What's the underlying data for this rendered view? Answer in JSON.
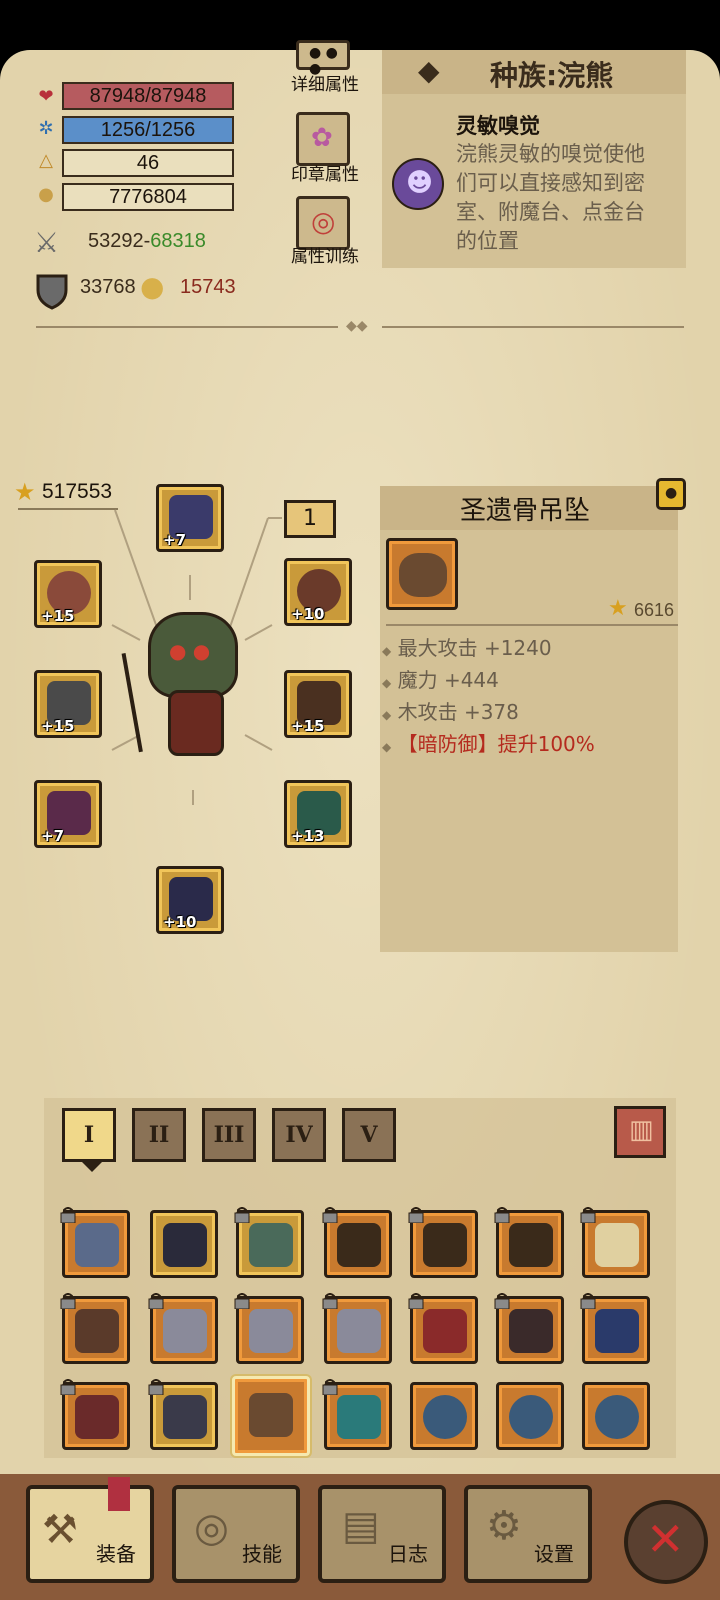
{
  "stats": {
    "hp": "87948/87948",
    "mp": "1256/1256",
    "level": "46",
    "gold": "7776804",
    "attack_min": "53292",
    "attack_dash": "-",
    "attack_max": "68318",
    "defense": "33768",
    "magic": "15743"
  },
  "menu": {
    "detail": "详细属性",
    "seal": "印章属性",
    "training": "属性训练"
  },
  "race": {
    "title": "种族:浣熊",
    "skill_name": "灵敏嗅觉",
    "skill_desc_1": "浣熊灵敏的嗅觉使他",
    "skill_desc_2": "们可以直接感知到密",
    "skill_desc_3": "室、附魔台、点金台",
    "skill_desc_4": "的位置"
  },
  "equipment": {
    "score": "517553",
    "ring_slot_number": "1",
    "slots": [
      {
        "name": "helmet",
        "plus": "+7"
      },
      {
        "name": "necklace",
        "plus": "+10"
      },
      {
        "name": "shield",
        "plus": "+15"
      },
      {
        "name": "weapon",
        "plus": "+15"
      },
      {
        "name": "armor",
        "plus": "+15"
      },
      {
        "name": "gloves",
        "plus": "+7"
      },
      {
        "name": "belt",
        "plus": "+13"
      },
      {
        "name": "boots",
        "plus": "+10"
      }
    ]
  },
  "item_detail": {
    "name": "圣遗骨吊坠",
    "score": "6616",
    "attr_1": "最大攻击 +1240",
    "attr_2": "魔力 +444",
    "attr_3": "木攻击 +378",
    "special_bracket_open": "【",
    "special_keyword": "暗防御",
    "special_bracket_close": "】",
    "special_effect": "提升100%"
  },
  "tabs": [
    "I",
    "II",
    "III",
    "IV",
    "V"
  ],
  "bottom_nav": {
    "equip": "装备",
    "skills": "技能",
    "log": "日志",
    "settings": "设置"
  },
  "colors": {
    "hp_bar": "#b65b5f",
    "mp_bar": "#5b8fc9",
    "attack_max": "#3a8a2a",
    "magic_value": "#8a2a1e",
    "special_text": "#b52a1e",
    "panel_bg": "#e2d3ab"
  }
}
